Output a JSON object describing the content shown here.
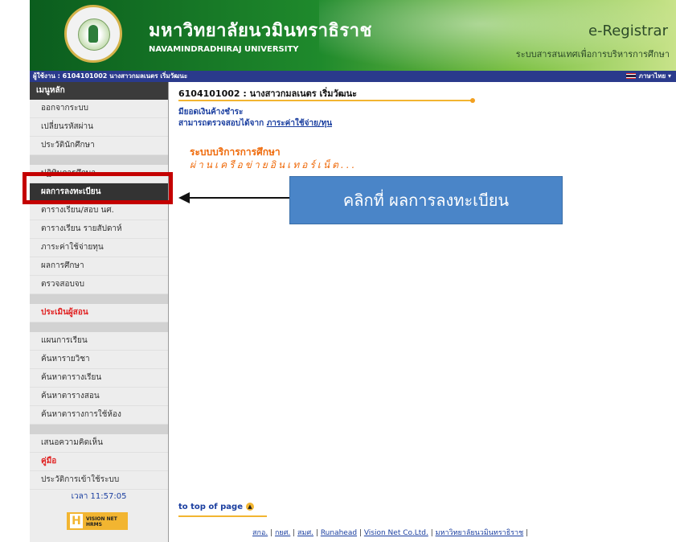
{
  "header": {
    "uni_th": "มหาวิทยาลัยนวมินทราธิราช",
    "uni_en": "NAVAMINDRADHIRAJ UNIVERSITY",
    "system": "e-Registrar",
    "system_sub": "ระบบสารสนเทศเพื่อการบริหารการศึกษา"
  },
  "userbar": {
    "user": "ผู้ใช้งาน : 6104101002 นางสาวกมลเนตร เริ่มวัฒนะ",
    "language": "ภาษาไทย ▾"
  },
  "sidebar": {
    "heading": "เมนูหลัก",
    "items": [
      "ออกจากระบบ",
      "เปลี่ยนรหัสผ่าน",
      "ประวัตินักศึกษา",
      "ปฏิทินการศึกษา",
      "ผลการลงทะเบียน",
      "ตารางเรียน/สอบ นศ.",
      "ตารางเรียน รายสัปดาห์",
      "ภาระค่าใช้จ่ายทุน",
      "ผลการศึกษา",
      "ตรวจสอบจบ",
      "ประเมินผู้สอน",
      "แผนการเรียน",
      "ค้นหารายวิชา",
      "ค้นหาตารางเรียน",
      "ค้นหาตารางสอน",
      "ค้นหาตารางการใช้ห้อง",
      "เสนอความคิดเห็น",
      "คู่มือ",
      "ประวัติการเข้าใช้ระบบ"
    ],
    "time": "เวลา 11:57:05",
    "vendor_logo": "VISION NET HRMS"
  },
  "content": {
    "student": "6104101002 : นางสาวกมลเนตร เริ่มวัฒนะ",
    "debt_notice": "มียอดเงินค้างชำระ",
    "check_prefix": "สามารถตรวจสอบได้จาก ",
    "check_link": "ภาระค่าใช้จ่าย/ทุน",
    "service_title": "ระบบบริการการศึกษา",
    "service_sub": "ผ่านเครือข่ายอินเทอร์เน็ต..."
  },
  "annotation": {
    "callout": "คลิกที่ ผลการลงทะเบียน"
  },
  "footer": {
    "top_link": "to top of page",
    "links": [
      "สกอ.",
      "กยศ.",
      "สมศ.",
      "Runahead",
      "Vision Net Co.Ltd.",
      "มหาวิทยาลัยนวมินทราธิราช"
    ]
  },
  "colors": {
    "header_green": "#1f8a2c",
    "userbar_blue": "#2a3a8c",
    "accent_orange": "#ef6a0a",
    "callout_blue": "#4a85c8",
    "highlight_red": "#c40000"
  }
}
